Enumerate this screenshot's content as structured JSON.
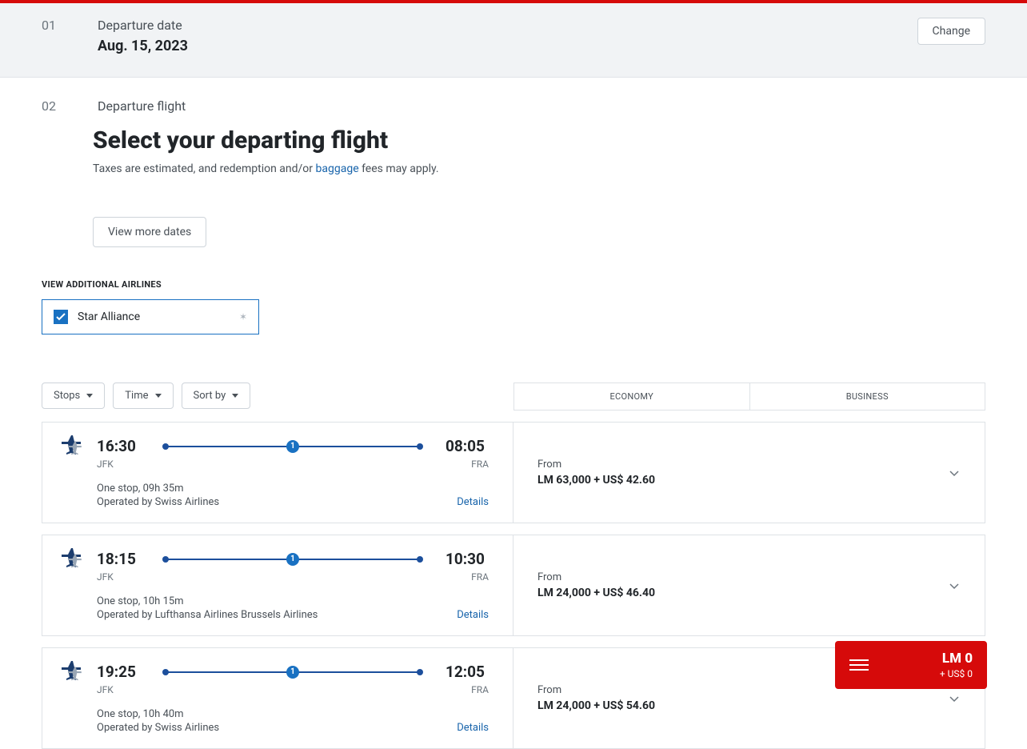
{
  "step01": {
    "num": "01",
    "title": "Departure date",
    "value": "Aug. 15, 2023",
    "change": "Change"
  },
  "step02": {
    "num": "02",
    "title": "Departure flight"
  },
  "heading": "Select your departing flight",
  "subtext_a": "Taxes are estimated, and redemption and/or ",
  "subtext_link": "baggage",
  "subtext_b": " fees may apply.",
  "view_more": "View more dates",
  "airlines_label": "VIEW ADDITIONAL AIRLINES",
  "airline": "Star Alliance",
  "filters": {
    "stops": "Stops",
    "time": "Time",
    "sort": "Sort by"
  },
  "tabs": {
    "economy": "ECONOMY",
    "business": "BUSINESS"
  },
  "stop_badge": "1",
  "flights": [
    {
      "dep": "16:30",
      "arr": "08:05",
      "dep_ap": "JFK",
      "arr_ap": "FRA",
      "stops": "One stop, 09h 35m",
      "op": "Operated by Swiss Airlines",
      "from": "From",
      "price": "LM 63,000 + US$ 42.60",
      "details": "Details"
    },
    {
      "dep": "18:15",
      "arr": "10:30",
      "dep_ap": "JFK",
      "arr_ap": "FRA",
      "stops": "One stop, 10h 15m",
      "op": "Operated by Lufthansa Airlines Brussels Airlines",
      "from": "From",
      "price": "LM 24,000 + US$ 46.40",
      "details": "Details"
    },
    {
      "dep": "19:25",
      "arr": "12:05",
      "dep_ap": "JFK",
      "arr_ap": "FRA",
      "stops": "One stop, 10h 40m",
      "op": "Operated by Swiss Airlines",
      "from": "From",
      "price": "LM 24,000 + US$ 54.60",
      "details": "Details"
    }
  ],
  "cart": {
    "lm": "LM 0",
    "us": "+ US$ 0"
  }
}
